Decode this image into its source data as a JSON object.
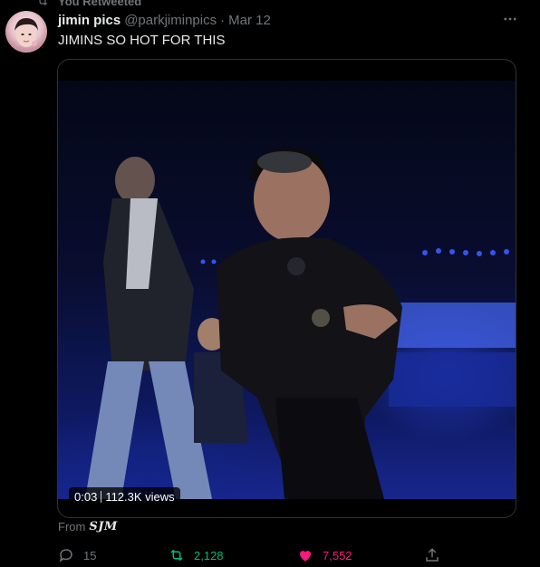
{
  "retweet_banner": {
    "text": "You Retweeted"
  },
  "tweet": {
    "display_name": "jimin pics",
    "handle": "@parkjiminpics",
    "separator": "·",
    "date": "Mar 12",
    "text": "JIMINS SO HOT FOR THIS",
    "media": {
      "type": "video",
      "duration": "0:03",
      "views": "112.3K views"
    },
    "source_prefix": "From",
    "source_name": "SJM",
    "stats": {
      "replies": "15",
      "retweets": "2,128",
      "likes": "7,552"
    }
  },
  "colors": {
    "background": "#000000",
    "muted": "#71767b",
    "retweet_active": "#00ba7c",
    "like_active": "#f91880"
  },
  "icons": {
    "more": "ellipsis-icon",
    "reply": "reply-icon",
    "retweet": "retweet-icon",
    "like": "heart-filled-icon",
    "share": "share-icon"
  }
}
